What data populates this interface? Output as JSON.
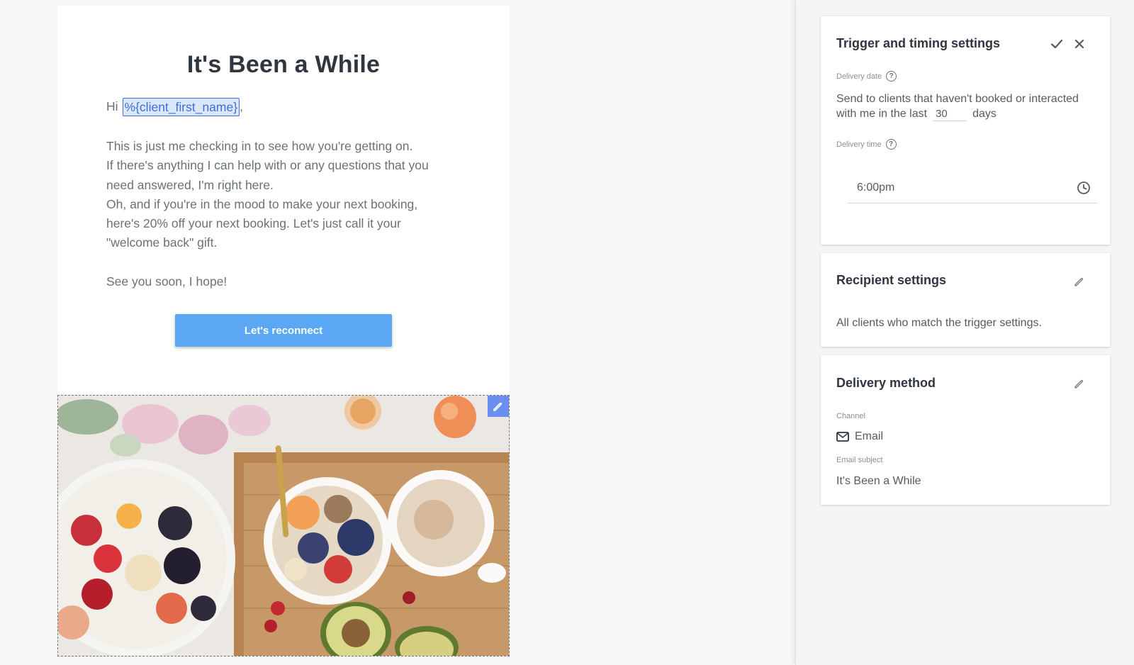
{
  "email": {
    "title": "It's Been a While",
    "greeting_prefix": "Hi",
    "variable": "%{client_first_name}",
    "greeting_suffix": ",",
    "paragraph_lines": [
      "This is just me checking in to see how you're getting on.",
      "If there's anything I can help with or any questions that you",
      "need answered, I'm right here.",
      "Oh, and if you're in the mood to make your next booking,",
      "here's 20% off your next booking. Let's just call it your",
      "\"welcome back\" gift."
    ],
    "signoff": "See you soon, I hope!",
    "cta_label": "Let's reconnect",
    "hero_image": "breakfast-food-photo",
    "hero_edit_icon": "pencil-icon"
  },
  "trigger": {
    "title": "Trigger and timing settings",
    "confirm_icon": "check-icon",
    "close_icon": "close-icon",
    "delivery_date_label": "Delivery date",
    "delivery_text_line1": "Send to clients that haven't booked or interacted",
    "delivery_text_prefix": "with me in the last",
    "days_value": "30",
    "days_suffix": "days",
    "delivery_time_label": "Delivery time",
    "time_value": "6:00pm",
    "time_icon": "clock-icon"
  },
  "recipient": {
    "title": "Recipient settings",
    "edit_icon": "pencil-icon",
    "text": "All clients who match the trigger settings."
  },
  "delivery": {
    "title": "Delivery method",
    "edit_icon": "pencil-icon",
    "channel_label": "Channel",
    "channel_icon": "email-icon",
    "channel_value": "Email",
    "subject_label": "Email subject",
    "subject_value": "It's Been a While"
  },
  "colors": {
    "accent": "#5aa7f4",
    "variable_chip": "#3d6fd8",
    "hero_edit_bg": "#6b8ff0"
  }
}
